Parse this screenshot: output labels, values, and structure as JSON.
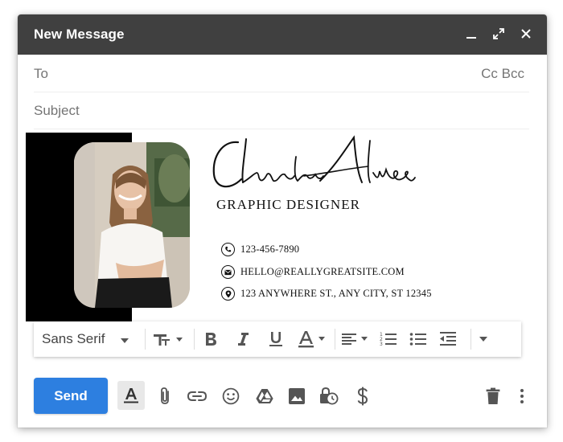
{
  "window": {
    "title": "New Message",
    "controls": [
      "minimize-icon",
      "expand-icon",
      "close-icon"
    ]
  },
  "fields": {
    "to_label": "To",
    "cc_bcc": "Cc Bcc",
    "subject_placeholder": "Subject"
  },
  "signature": {
    "name_script": "Claudia Alves",
    "job_title": "GRAPHIC DESIGNER",
    "phone": "123-456-7890",
    "email": "HELLO@REALLYGREATSITE.COM",
    "address": "123 ANYWHERE ST., ANY CITY, ST 12345"
  },
  "toolbar": {
    "font": "Sans Serif",
    "buttons": [
      "font-size-icon",
      "bold-icon",
      "italic-icon",
      "underline-icon",
      "text-color-icon",
      "align-icon",
      "numbered-list-icon",
      "bulleted-list-icon",
      "indent-less-icon",
      "more-formatting-icon"
    ]
  },
  "bottom": {
    "send_label": "Send",
    "icons": [
      "formatting-options-icon",
      "attach-icon",
      "link-icon",
      "emoji-icon",
      "drive-icon",
      "photo-icon",
      "confidential-mode-icon",
      "dollar-icon",
      "trash-icon",
      "more-options-icon"
    ]
  }
}
